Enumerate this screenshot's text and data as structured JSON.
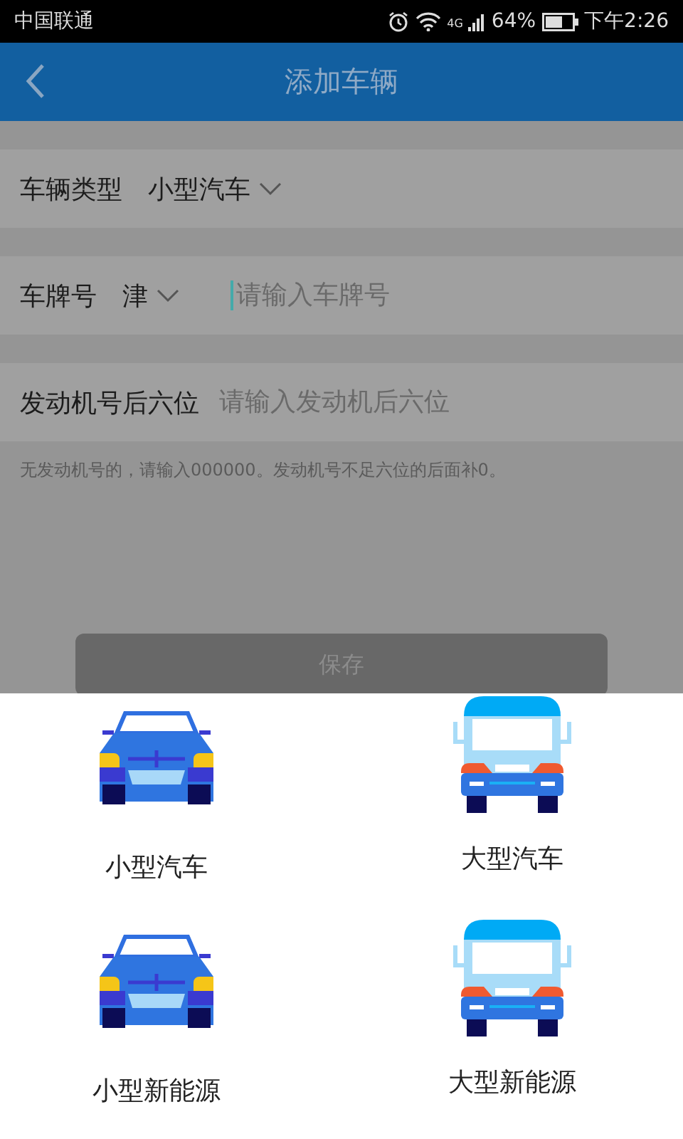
{
  "status_bar": {
    "carrier": "中国联通",
    "network": "4G",
    "battery": "64%",
    "time": "下午2:26"
  },
  "header": {
    "title": "添加车辆"
  },
  "form": [
    {
      "kind": "select",
      "label": "车辆类型",
      "value": "小型汽车"
    },
    {
      "kind": "plate",
      "label": "车牌号",
      "value": "津",
      "placeholder": "请输入车牌号"
    },
    {
      "kind": "input",
      "label": "发动机号后六位",
      "placeholder": "请输入发动机后六位"
    }
  ],
  "hint": "无发动机号的，请输入000000。发动机号不足六位的后面补0。",
  "save_button": "保存",
  "vehicle_sheet": [
    {
      "kind": "car",
      "label": "小型汽车"
    },
    {
      "kind": "van",
      "label": "大型汽车"
    },
    {
      "kind": "car",
      "label": "小型新能源"
    },
    {
      "kind": "van",
      "label": "大型新能源"
    }
  ]
}
